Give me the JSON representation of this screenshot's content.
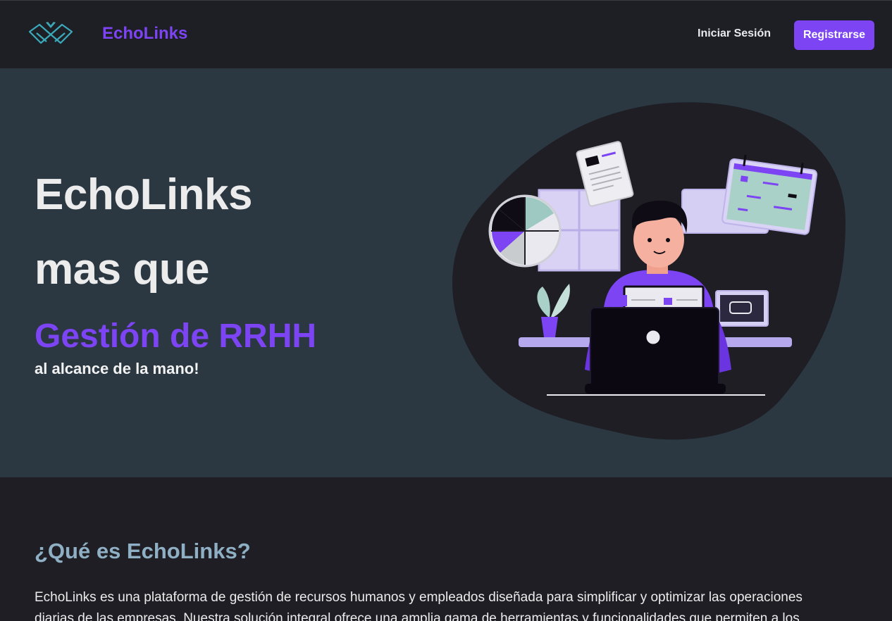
{
  "nav": {
    "brand": "EchoLinks",
    "login_label": "Iniciar Sesión",
    "register_label": "Registrarse",
    "logo_icon": "book-bird-logo-icon"
  },
  "hero": {
    "line1": "EchoLinks",
    "line2": "mas que",
    "highlight": "Gestión de RRHH",
    "subtitle": "al alcance de la mano!",
    "illustration": "person-working-on-laptop-illustration"
  },
  "about": {
    "title": "¿Qué es EchoLinks?",
    "text": "EchoLinks es una plataforma de gestión de recursos humanos y empleados diseñada para simplificar y optimizar las operaciones diarias de las empresas. Nuestra solución integral ofrece una amplia gama de herramientas y funcionalidades que permiten a los"
  },
  "colors": {
    "accent": "#7c44f3",
    "nav_bg": "#1e1f24",
    "hero_bg": "#2b3842",
    "section_title": "#8fb0c4"
  }
}
